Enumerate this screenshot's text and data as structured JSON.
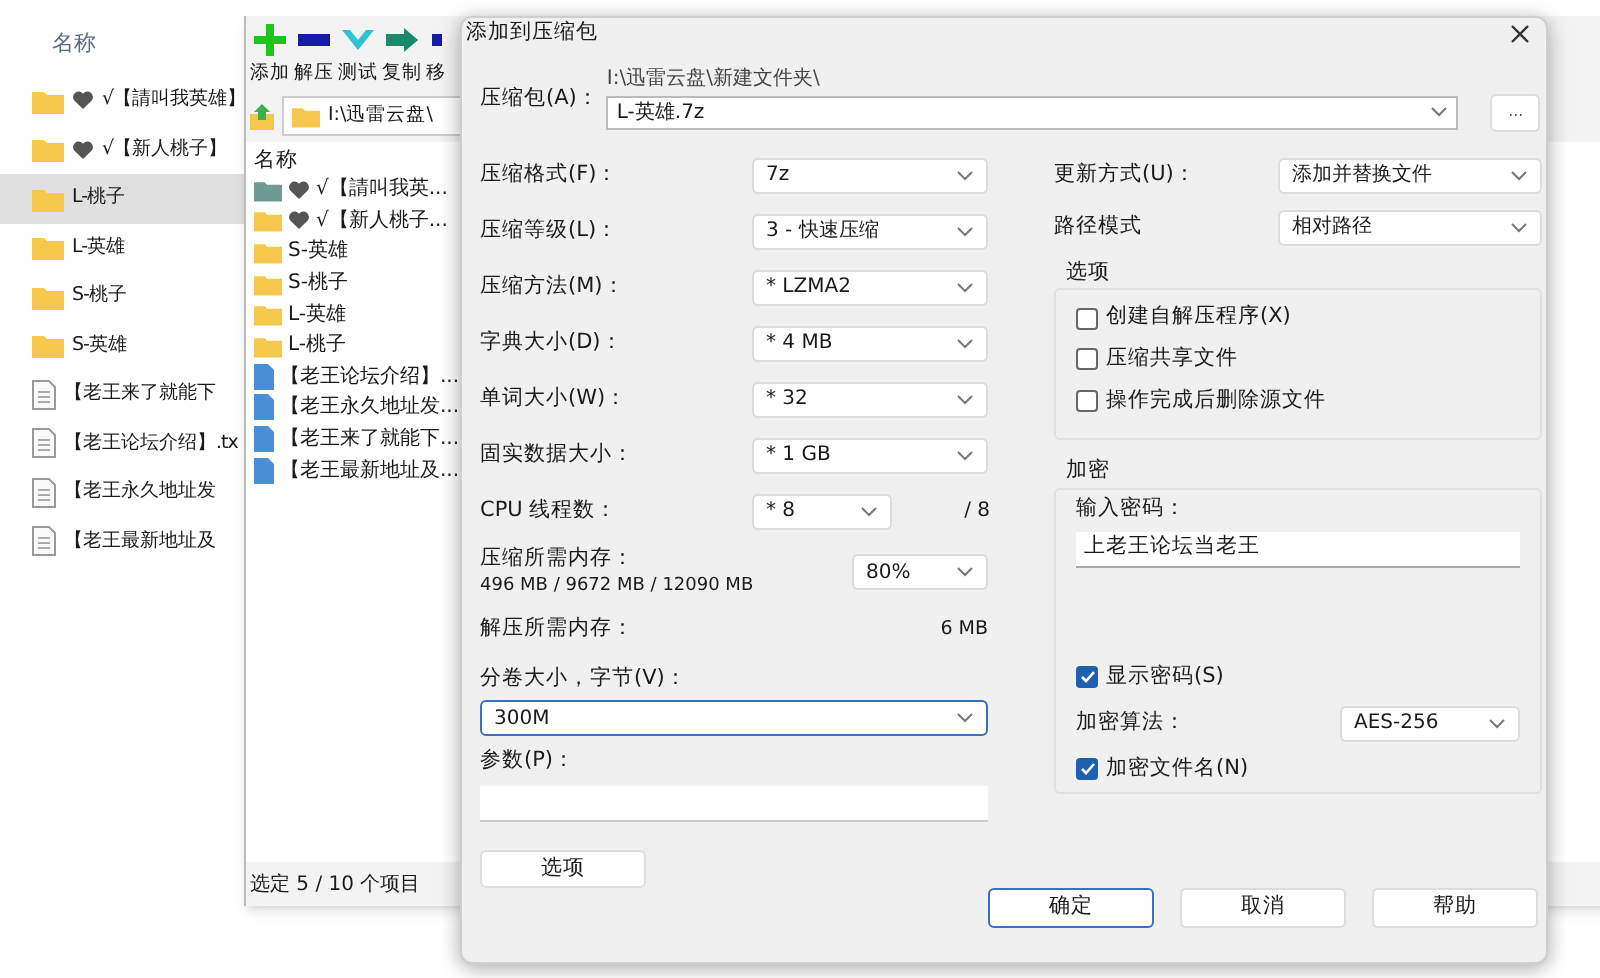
{
  "explorer": {
    "column_header": "名称",
    "items": [
      {
        "kind": "folder",
        "heart": true,
        "name": "√【請叫我英雄】",
        "selected": false
      },
      {
        "kind": "folder",
        "heart": true,
        "name": "√【新人桃子】",
        "selected": false
      },
      {
        "kind": "folder",
        "heart": false,
        "name": "L-桃子",
        "selected": true
      },
      {
        "kind": "folder",
        "heart": false,
        "name": "L-英雄",
        "selected": false
      },
      {
        "kind": "folder",
        "heart": false,
        "name": "S-桃子",
        "selected": false
      },
      {
        "kind": "folder",
        "heart": false,
        "name": "S-英雄",
        "selected": false
      },
      {
        "kind": "file",
        "heart": false,
        "name": "【老王来了就能下",
        "selected": false
      },
      {
        "kind": "file",
        "heart": false,
        "name": "【老王论坛介绍】.tx",
        "selected": false
      },
      {
        "kind": "file",
        "heart": false,
        "name": "【老王永久地址发",
        "selected": false
      },
      {
        "kind": "file",
        "heart": false,
        "name": "【老王最新地址及",
        "selected": false
      }
    ]
  },
  "archiver": {
    "toolbar": [
      {
        "kind": "add",
        "label": "添加"
      },
      {
        "kind": "extract",
        "label": "解压"
      },
      {
        "kind": "test",
        "label": "测试"
      },
      {
        "kind": "copy",
        "label": "复制"
      },
      {
        "kind": "move",
        "label": "移"
      }
    ],
    "address": "I:\\迅雷云盘\\",
    "column_header": "名称",
    "items": [
      {
        "kind": "teal-folder",
        "heart": true,
        "name": "√【請叫我英..."
      },
      {
        "kind": "folder",
        "heart": true,
        "name": "√【新人桃子..."
      },
      {
        "kind": "folder",
        "heart": false,
        "name": "S-英雄"
      },
      {
        "kind": "folder",
        "heart": false,
        "name": "S-桃子"
      },
      {
        "kind": "folder",
        "heart": false,
        "name": "L-英雄"
      },
      {
        "kind": "folder",
        "heart": false,
        "name": "L-桃子"
      },
      {
        "kind": "file",
        "heart": false,
        "name": "【老王论坛介绍】..."
      },
      {
        "kind": "file",
        "heart": false,
        "name": "【老王永久地址发..."
      },
      {
        "kind": "file",
        "heart": false,
        "name": "【老王来了就能下..."
      },
      {
        "kind": "file",
        "heart": false,
        "name": "【老王最新地址及..."
      }
    ],
    "status": "选定 5 / 10 个项目"
  },
  "dialog": {
    "title": "添加到压缩包",
    "archive": {
      "label": "压缩包(A)：",
      "folder": "I:\\迅雷云盘\\新建文件夹\\",
      "value": "L-英雄.7z",
      "browse": "..."
    },
    "left_fields": [
      {
        "label": "压缩格式(F)：",
        "value": "7z"
      },
      {
        "label": "压缩等级(L)：",
        "value": "3 - 快速压缩"
      },
      {
        "label": "压缩方法(M)：",
        "value": "* LZMA2"
      },
      {
        "label": "字典大小(D)：",
        "value": "* 4 MB"
      },
      {
        "label": "单词大小(W)：",
        "value": "* 32"
      },
      {
        "label": "固实数据大小：",
        "value": "* 1 GB"
      },
      {
        "label": "CPU 线程数：",
        "value": "* 8",
        "suffix": "/ 8"
      }
    ],
    "memory": {
      "label": "压缩所需内存：",
      "detail": "496 MB / 9672 MB / 12090 MB",
      "value": "80%"
    },
    "decompress": {
      "label": "解压所需内存：",
      "value": "6 MB"
    },
    "volume": {
      "label": "分卷大小，字节(V)：",
      "value": "300M"
    },
    "params": {
      "label": "参数(P)："
    },
    "options_button": "选项",
    "update": {
      "label": "更新方式(U)：",
      "value": "添加并替换文件"
    },
    "path_mode": {
      "label": "路径模式",
      "value": "相对路径"
    },
    "options": {
      "title": "选项",
      "items": [
        {
          "label": "创建自解压程序(X)",
          "checked": false
        },
        {
          "label": "压缩共享文件",
          "checked": false
        },
        {
          "label": "操作完成后删除源文件",
          "checked": false
        }
      ]
    },
    "encryption": {
      "title": "加密",
      "password_label": "输入密码：",
      "password": "上老王论坛当老王",
      "show_password": {
        "label": "显示密码(S)",
        "checked": true
      },
      "method_label": "加密算法：",
      "method": "AES-256",
      "encrypt_names": {
        "label": "加密文件名(N)",
        "checked": true
      }
    },
    "buttons": [
      {
        "label": "确定",
        "default": true
      },
      {
        "label": "取消",
        "default": false
      },
      {
        "label": "帮助",
        "default": false
      }
    ]
  }
}
